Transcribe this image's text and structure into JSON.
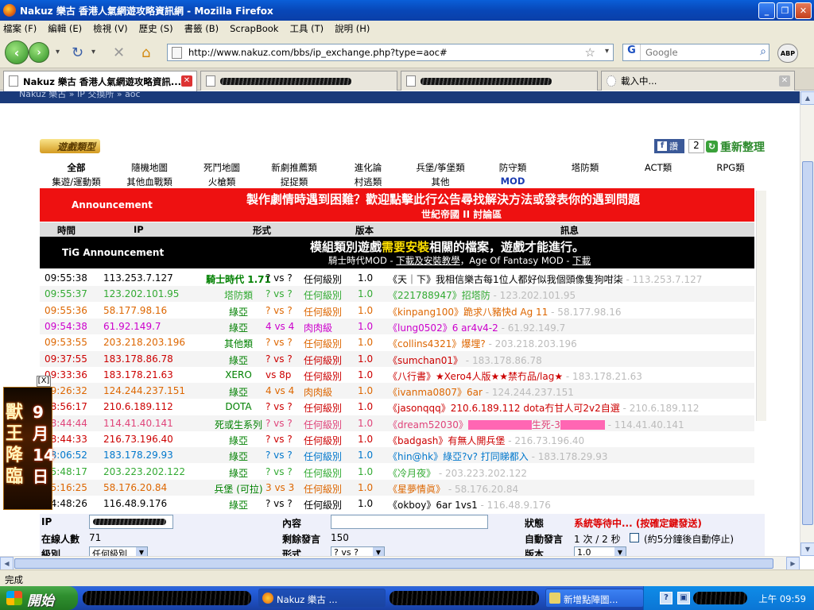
{
  "window": {
    "title": "Nakuz 樂古 香港人氣網遊攻略資訊網 - Mozilla Firefox"
  },
  "menu": [
    "檔案 (F)",
    "編輯 (E)",
    "檢視 (V)",
    "歷史 (S)",
    "書籤 (B)",
    "ScrapBook",
    "工具 (T)",
    "說明 (H)"
  ],
  "nav": {
    "url": "http://www.nakuz.com/bbs/ip_exchange.php?type=aoc#",
    "search_placeholder": "Google",
    "search_engine": "G",
    "abp": "ABP"
  },
  "tabs": [
    {
      "label": "Nakuz 樂古 香港人氣網遊攻略資訊...",
      "active": true
    },
    {
      "label": "",
      "active": false
    },
    {
      "label": "",
      "active": false
    },
    {
      "label": "載入中...",
      "active": false
    }
  ],
  "page": {
    "breadcrumb": "Nakuz 樂古 » IP 交換所 » aoc",
    "game_type": "遊戲類型",
    "fb_label": "讚",
    "fb_count": "2",
    "refresh": "重新整理",
    "categories_row1": [
      "全部",
      "隨機地圖",
      "死鬥地圖",
      "新劇推薦類",
      "進化論",
      "兵堡/筝堡類",
      "防守類",
      "塔防類",
      "ACT類",
      "RPG類"
    ],
    "categories_row2": [
      "集遊/運動類",
      "其他血戰類",
      "火槍類",
      "捉捉類",
      "村逃類",
      "其他",
      "MOD"
    ],
    "announcement": {
      "label": "Announcement",
      "line1": "製作劇情時遇到困難？歡迎點擊此行公告尋找解決方法或發表你的遇到問題",
      "line2": "世紀帝國 II 討論區"
    },
    "columns": {
      "time": "時間",
      "ip": "IP",
      "type": "形式",
      "version": "版本",
      "message": "訊息"
    },
    "tig": {
      "label": "TiG Announcement",
      "line1_a": "模組類別遊戲",
      "line1_b": "需要安裝",
      "line1_c": "相關的檔案，遊戲才能進行。",
      "line2_a": "騎士時代MOD - ",
      "line2_b": "下載及安裝教學",
      "line2_c": "，Age Of Fantasy MOD - ",
      "line2_d": "下載"
    },
    "rows": [
      {
        "time": "09:55:38",
        "ip": "113.253.7.127",
        "type": "騎士時代 1.71",
        "vs": "? vs ?",
        "level": "任何級別",
        "ver": "1.0",
        "msg": "《天｜下》我相信樂古每1位人都好似我個頭像隻狗咁柒",
        "tail": " - 113.253.7.127",
        "color": "#000000",
        "typecolor": "#008000",
        "typebold": true
      },
      {
        "time": "09:55:37",
        "ip": "123.202.101.95",
        "type": "塔防類",
        "vs": "? vs ?",
        "level": "任何級別",
        "ver": "1.0",
        "msg": "《221788947》招塔防",
        "tail": " - 123.202.101.95",
        "color": "#33aa33",
        "typecolor": "#33aa33"
      },
      {
        "time": "09:55:36",
        "ip": "58.177.98.16",
        "type": "綠亞",
        "vs": "? vs ?",
        "level": "任何級別",
        "ver": "1.0",
        "msg": "《kinpang100》跪求八豬快d Ag   11",
        "tail": " - 58.177.98.16",
        "color": "#dd6600",
        "typecolor": "#008000"
      },
      {
        "time": "09:54:38",
        "ip": "61.92.149.7",
        "type": "綠亞",
        "vs": "4 vs 4",
        "level": "肉肉級",
        "ver": "1.0",
        "msg": "《lung0502》6 ar4v4-2",
        "tail": " - 61.92.149.7",
        "color": "#cc00cc",
        "typecolor": "#008000"
      },
      {
        "time": "09:53:55",
        "ip": "203.218.203.196",
        "type": "其他類",
        "vs": "? vs ?",
        "level": "任何級別",
        "ver": "1.0",
        "msg": "《collins4321》爆埋?",
        "tail": " - 203.218.203.196",
        "color": "#dd6600",
        "typecolor": "#008000"
      },
      {
        "time": "09:37:55",
        "ip": "183.178.86.78",
        "type": "綠亞",
        "vs": "? vs ?",
        "level": "任何級別",
        "ver": "1.0",
        "msg": "《sumchan01》",
        "tail": " - 183.178.86.78",
        "color": "#cc0000",
        "typecolor": "#008000"
      },
      {
        "time": "09:33:36",
        "ip": "183.178.21.63",
        "type": "XERO",
        "vs": "vs 8p",
        "level": "任何級別",
        "ver": "1.0",
        "msg": "《八行書》★Xero4人版★★禁冇品/lag★",
        "tail": " - 183.178.21.63",
        "color": "#cc0000",
        "typecolor": "#008000"
      },
      {
        "time": "09:26:32",
        "ip": "124.244.237.151",
        "type": "綠亞",
        "vs": "4 vs 4",
        "level": "肉肉級",
        "ver": "1.0",
        "msg": "《ivanma0807》6ar",
        "tail": " - 124.244.237.151",
        "color": "#dd6600",
        "typecolor": "#008000"
      },
      {
        "time": "08:56:17",
        "ip": "210.6.189.112",
        "type": "DOTA",
        "vs": "? vs ?",
        "level": "任何級別",
        "ver": "1.0",
        "msg": "《jasonqqq》210.6.189.112  dota冇甘人可2v2自選",
        "tail": " - 210.6.189.112",
        "color": "#cc0000",
        "typecolor": "#008000"
      },
      {
        "time": "08:44:44",
        "ip": "114.41.40.141",
        "type": "死或生系列",
        "vs": "? vs ?",
        "level": "任何級別",
        "ver": "1.0",
        "msg": "《dream52030》",
        "mid": "生死-3",
        "tail": " - 114.41.40.141",
        "color": "#e0447a",
        "typecolor": "#008000",
        "hidden": true
      },
      {
        "time": "08:44:33",
        "ip": "216.73.196.40",
        "type": "綠亞",
        "vs": "? vs ?",
        "level": "任何級別",
        "ver": "1.0",
        "msg": "《badgash》有無人開兵堡",
        "tail": " - 216.73.196.40",
        "color": "#cc0000",
        "typecolor": "#008000"
      },
      {
        "time": "08:06:52",
        "ip": "183.178.29.93",
        "type": "綠亞",
        "vs": "? vs ?",
        "level": "任何級別",
        "ver": "1.0",
        "msg": "《hin@hk》綠亞?v?  打同睇都入",
        "tail": " - 183.178.29.93",
        "color": "#0077cc",
        "typecolor": "#008000"
      },
      {
        "time": "05:48:17",
        "ip": "203.223.202.122",
        "type": "綠亞",
        "vs": "? vs ?",
        "level": "任何級別",
        "ver": "1.0",
        "msg": "《冷月夜》",
        "tail": " - 203.223.202.122",
        "color": "#33aa33",
        "typecolor": "#008000"
      },
      {
        "time": "05:16:25",
        "ip": "58.176.20.84",
        "type": "兵堡 (可拉)",
        "vs": "3 vs 3",
        "level": "任何級別",
        "ver": "1.0",
        "msg": "《星夢情眞》",
        "tail": " - 58.176.20.84",
        "color": "#dd6600",
        "typecolor": "#008000"
      },
      {
        "time": "04:48:26",
        "ip": "116.48.9.176",
        "type": "綠亞",
        "vs": "? vs ?",
        "level": "任何級別",
        "ver": "1.0",
        "msg": "《okboy》6ar 1vs1",
        "tail": " - 116.48.9.176",
        "color": "#000000",
        "typecolor": "#008000"
      }
    ],
    "form": {
      "ip_label": "IP",
      "content_label": "內容",
      "status_label": "狀態",
      "status_value": "系統等待中... (按確定鍵發送)",
      "online_label": "在線人數",
      "online_value": "71",
      "remaining_label": "剩餘發言",
      "remaining_value": "150",
      "auto_label": "自動發言",
      "auto_value": "1 次 / 2 秒",
      "auto_hint": "(約5分鐘後自動停止)",
      "level_label": "級別",
      "level_value": "任何級別",
      "type_label": "形式",
      "type_value": "? vs ?",
      "ver_label": "版本",
      "ver_value": "1.0"
    }
  },
  "ad": {
    "close": "[X]",
    "line1": "獸王降臨",
    "line2": "9月14日"
  },
  "status": "完成",
  "taskbar": {
    "start": "開始",
    "task1": "Nakuz 樂古 ...",
    "task2": "新增點陣圖...",
    "clock": "上午 09:59"
  },
  "colors": {
    "red_banner": "#ee1111",
    "titlebar": "#0a5fd8",
    "accent_link": "#1a3ab0"
  }
}
